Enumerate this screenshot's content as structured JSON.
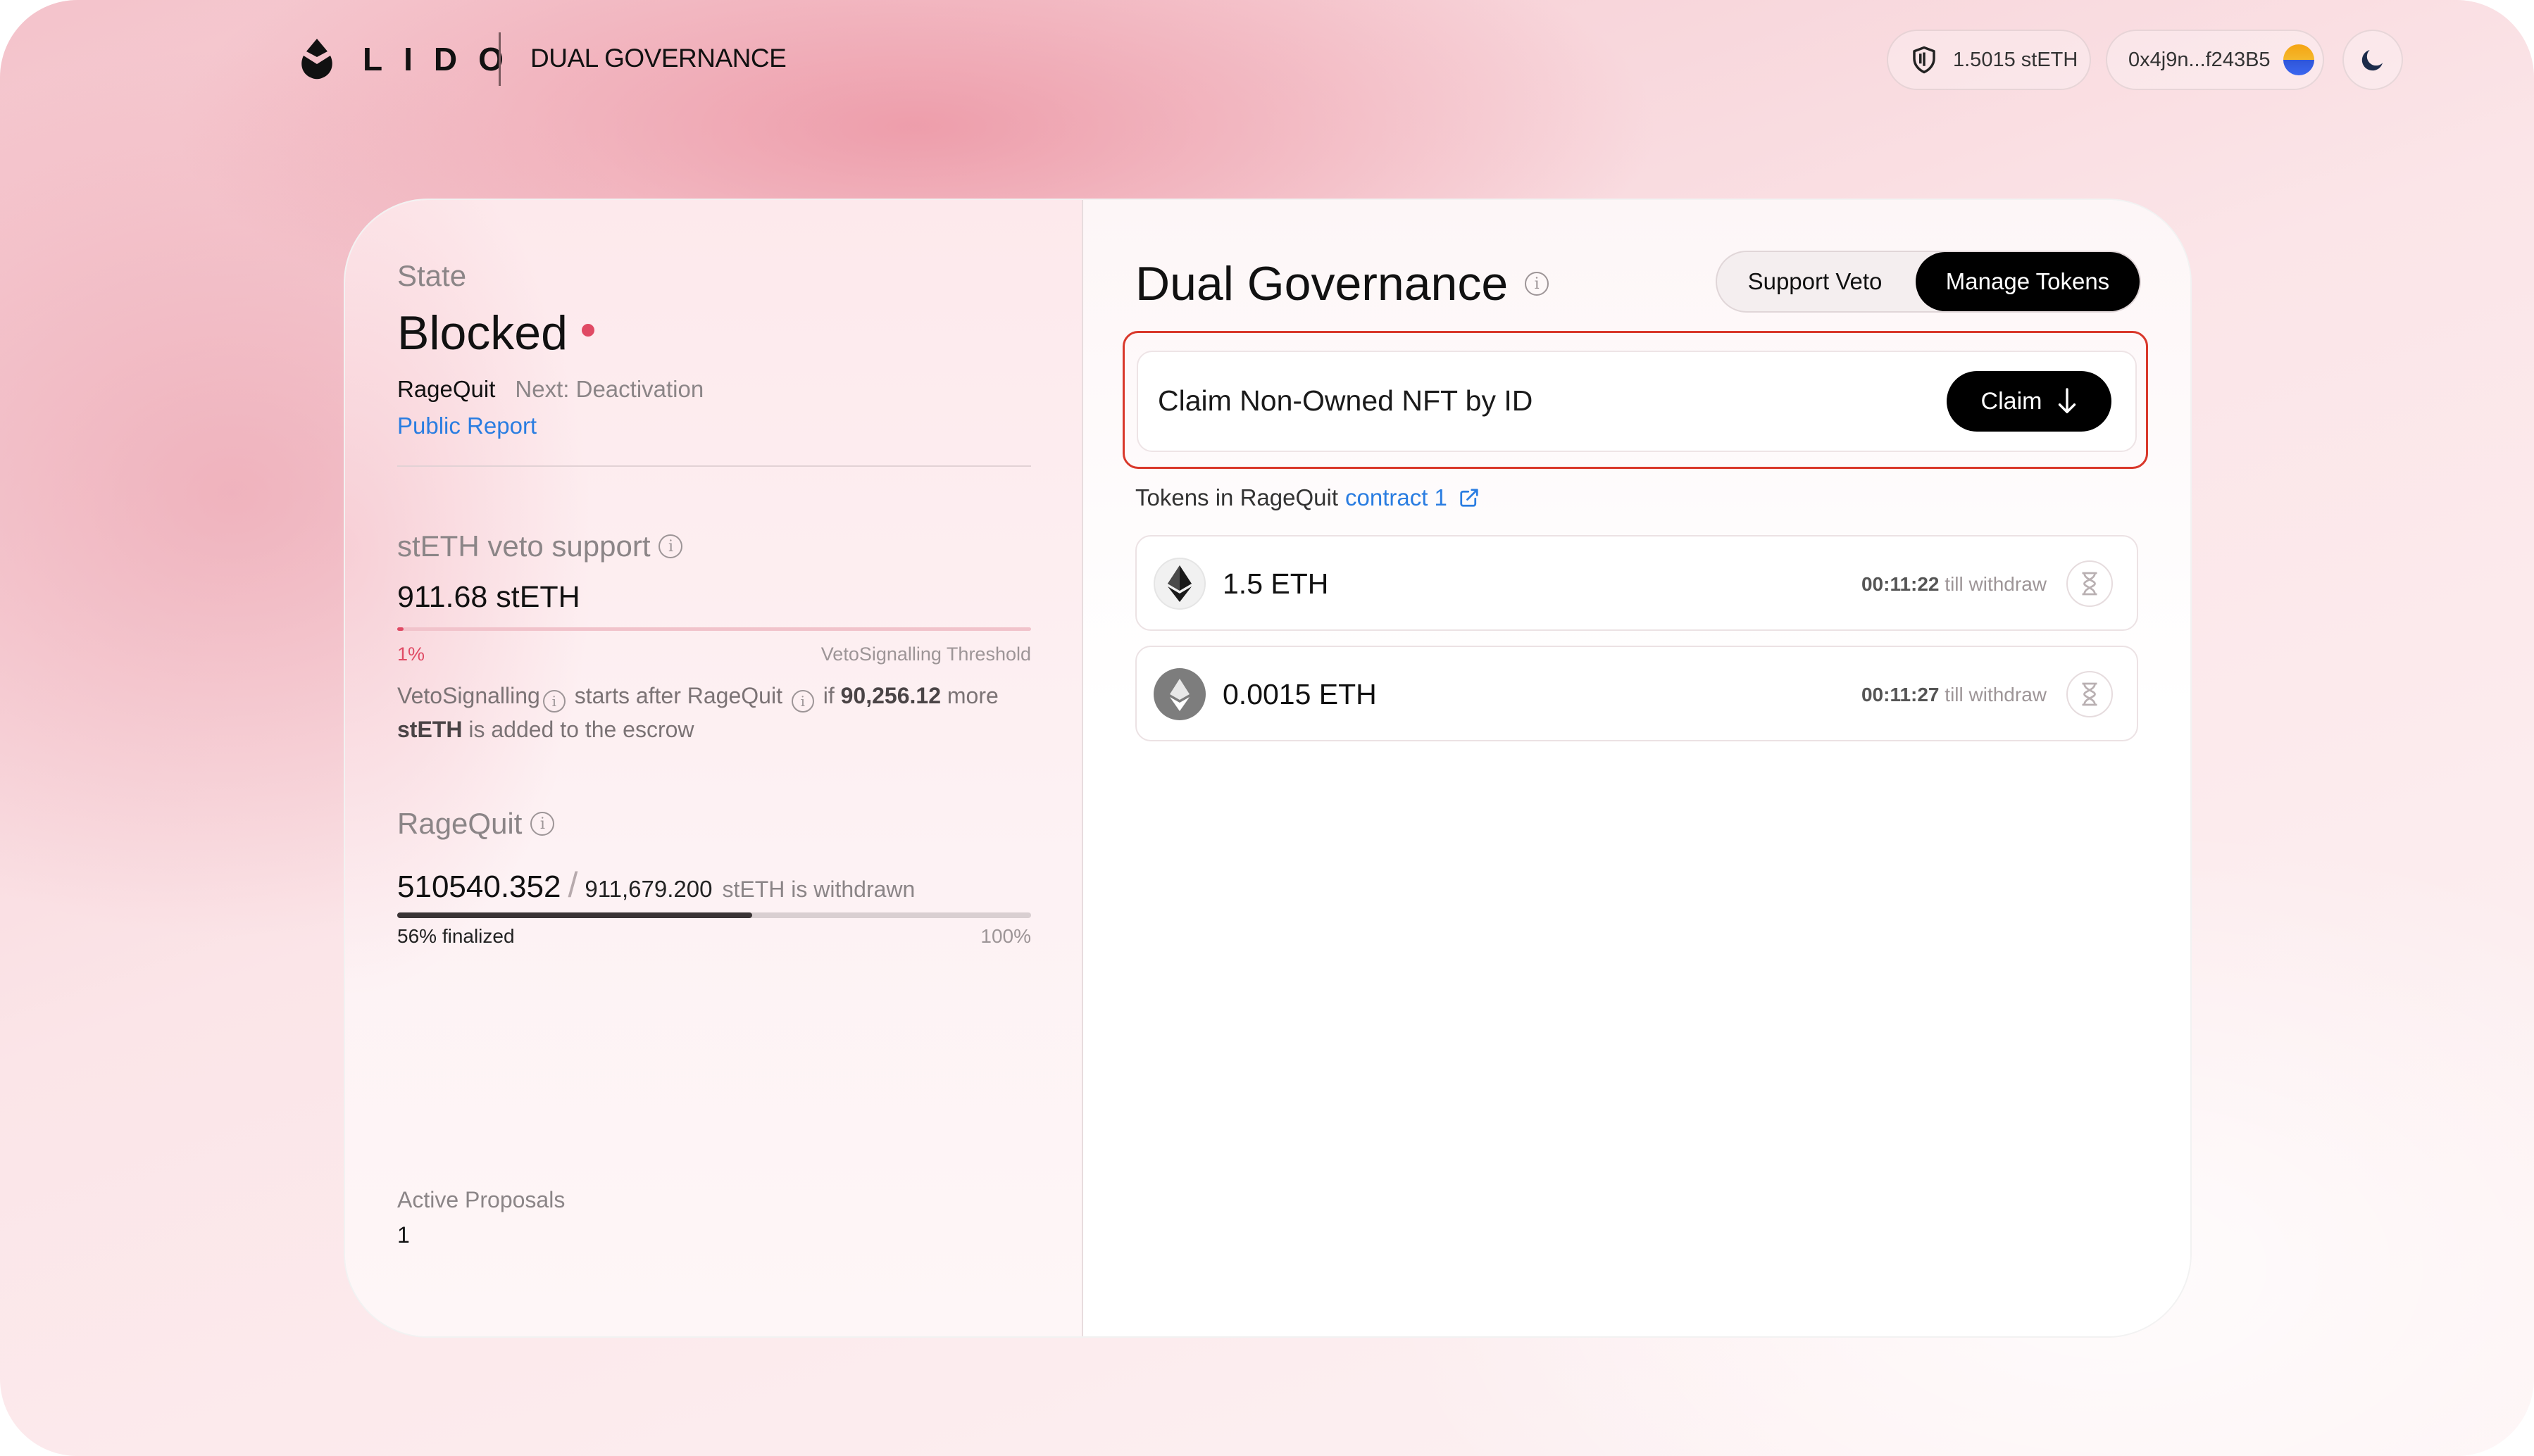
{
  "header": {
    "logo_text": "LIDO",
    "app_name": "DUAL GOVERNANCE",
    "balance": "1.5015 stETH",
    "wallet": "0x4j9n...f243B5",
    "icons": {
      "balance": "shield-icon",
      "theme": "moon-icon",
      "logo": "lido-drop-icon"
    }
  },
  "state": {
    "label": "State",
    "value": "Blocked",
    "current": "RageQuit",
    "next": "Next: Deactivation",
    "report_link": "Public Report",
    "status_color": "#e04a64"
  },
  "veto": {
    "label": "stETH veto support",
    "value": "911.68 stETH",
    "progress_percent": 1,
    "percent_label": "1%",
    "threshold_label": "VetoSignalling Threshold",
    "desc": {
      "part1": "VetoSignalling",
      "part2": "starts after RageQuit",
      "part3": "if",
      "amount": "90,256.12",
      "part4": "more",
      "token": "stETH",
      "part5": "is added to the escrow"
    }
  },
  "ragequit": {
    "label": "RageQuit",
    "withdrawn": "510540.352",
    "total": "911,679.200",
    "note": "stETH is withdrawn",
    "progress_percent": 56,
    "finalized_label": "56% finalized",
    "full_label": "100%"
  },
  "proposals": {
    "label": "Active Proposals",
    "value": "1"
  },
  "governance": {
    "title": "Dual Governance",
    "tabs": [
      {
        "label": "Support Veto",
        "active": false
      },
      {
        "label": "Manage Tokens",
        "active": true
      }
    ],
    "claim_title": "Claim Non-Owned NFT by ID",
    "claim_button": "Claim",
    "tokens_label": "Tokens in RageQuit",
    "contract_link": "contract 1",
    "tokens": [
      {
        "amount": "1.5 ETH",
        "time": "00:11:22",
        "suffix": "till withdraw"
      },
      {
        "amount": "0.0015 ETH",
        "time": "00:11:27",
        "suffix": "till withdraw"
      }
    ],
    "highlight_color": "#d9382b"
  }
}
